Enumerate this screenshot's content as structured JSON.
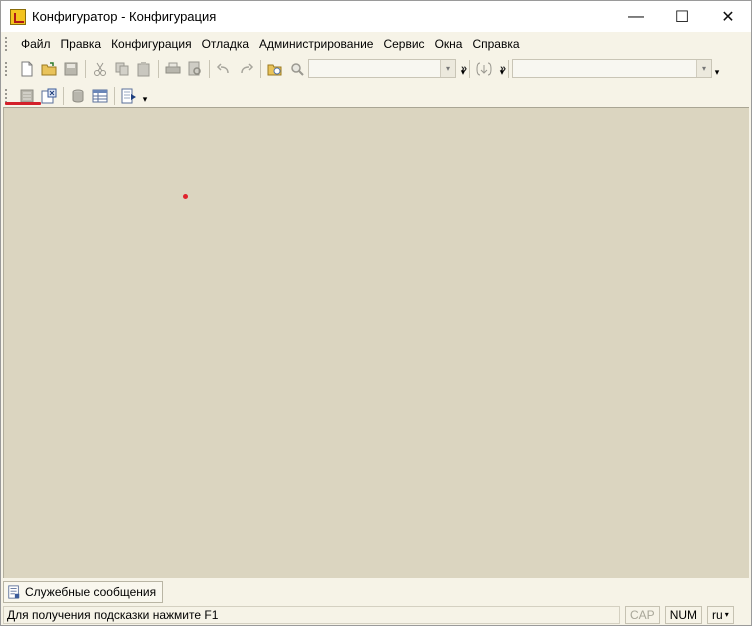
{
  "window": {
    "title": "Конфигуратор - Конфигурация",
    "controls": {
      "minimize": "—",
      "maximize": "☐",
      "close": "✕"
    }
  },
  "menu": {
    "items": [
      "Файл",
      "Правка",
      "Конфигурация",
      "Отладка",
      "Администрирование",
      "Сервис",
      "Окна",
      "Справка"
    ]
  },
  "toolbar": {
    "chevron": "»",
    "dropdown_arrow": "▾",
    "search_combo_value": "",
    "config_combo_value": "",
    "more_arrow": "▾"
  },
  "messages_panel": {
    "label": "Служебные сообщения"
  },
  "statusbar": {
    "hint": "Для получения подсказки нажмите F1",
    "cap": "CAP",
    "num": "NUM",
    "lang": "ru",
    "lang_arrow": "▾"
  },
  "colors": {
    "workspace_bg": "#dbd5c0",
    "chrome_bg": "#f6f3e7",
    "accent_red": "#d3202a"
  }
}
